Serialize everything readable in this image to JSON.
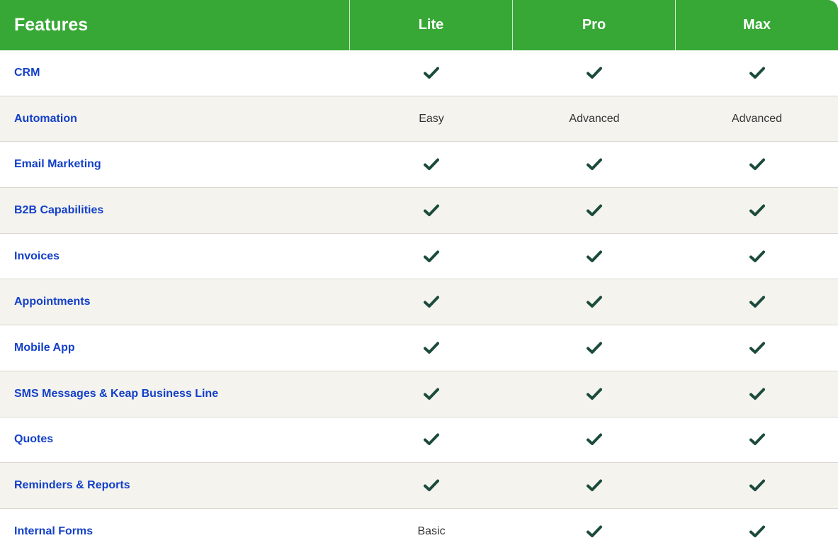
{
  "header": {
    "feature_label": "Features",
    "plans": [
      "Lite",
      "Pro",
      "Max"
    ]
  },
  "colors": {
    "header_bg": "#37a836",
    "feature_text": "#1340c8",
    "check": "#1b4b3c",
    "alt_row_bg": "#f4f3ee"
  },
  "rows": [
    {
      "feature": "CRM",
      "lite": {
        "type": "check"
      },
      "pro": {
        "type": "check"
      },
      "max": {
        "type": "check"
      }
    },
    {
      "feature": "Automation",
      "lite": {
        "type": "text",
        "text": "Easy"
      },
      "pro": {
        "type": "text",
        "text": "Advanced"
      },
      "max": {
        "type": "text",
        "text": "Advanced"
      }
    },
    {
      "feature": "Email Marketing",
      "lite": {
        "type": "check"
      },
      "pro": {
        "type": "check"
      },
      "max": {
        "type": "check"
      }
    },
    {
      "feature": "B2B Capabilities",
      "lite": {
        "type": "check"
      },
      "pro": {
        "type": "check"
      },
      "max": {
        "type": "check"
      }
    },
    {
      "feature": "Invoices",
      "lite": {
        "type": "check"
      },
      "pro": {
        "type": "check"
      },
      "max": {
        "type": "check"
      }
    },
    {
      "feature": "Appointments",
      "lite": {
        "type": "check"
      },
      "pro": {
        "type": "check"
      },
      "max": {
        "type": "check"
      }
    },
    {
      "feature": "Mobile App",
      "lite": {
        "type": "check"
      },
      "pro": {
        "type": "check"
      },
      "max": {
        "type": "check"
      }
    },
    {
      "feature": "SMS Messages & Keap Business Line",
      "lite": {
        "type": "check"
      },
      "pro": {
        "type": "check"
      },
      "max": {
        "type": "check"
      }
    },
    {
      "feature": "Quotes",
      "lite": {
        "type": "check"
      },
      "pro": {
        "type": "check"
      },
      "max": {
        "type": "check"
      }
    },
    {
      "feature": "Reminders & Reports",
      "lite": {
        "type": "check"
      },
      "pro": {
        "type": "check"
      },
      "max": {
        "type": "check"
      }
    },
    {
      "feature": "Internal Forms",
      "lite": {
        "type": "text",
        "text": "Basic"
      },
      "pro": {
        "type": "check"
      },
      "max": {
        "type": "check"
      }
    }
  ],
  "icons": {
    "check": "checkmark-icon"
  }
}
